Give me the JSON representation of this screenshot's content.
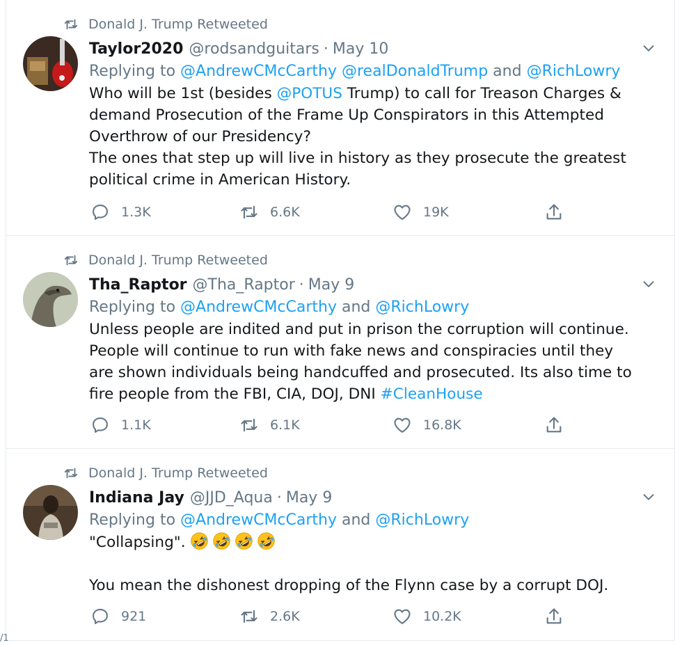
{
  "tweets": [
    {
      "retweeted_by": "Donald J. Trump Retweeted",
      "name": "Taylor2020",
      "handle": "@rodsandguitars",
      "date": "May 10",
      "reply_prefix": "Replying to ",
      "reply_parts": [
        "@AndrewCMcCarthy",
        " ",
        "@realDonaldTrump",
        " and ",
        "@RichLowry"
      ],
      "text_parts": [
        "Who will be 1st (besides ",
        "@POTUS",
        " Trump) to call for Treason Charges & demand Prosecution of the Frame Up Conspirators in this Attempted Overthrow of our Presidency?\nThe ones that step up will live in history as they prosecute the greatest political crime in American History."
      ],
      "stats": {
        "replies": "1.3K",
        "retweets": "6.6K",
        "likes": "19K"
      }
    },
    {
      "retweeted_by": "Donald J. Trump Retweeted",
      "name": "Tha_Raptor",
      "handle": "@Tha_Raptor",
      "date": "May 9",
      "reply_prefix": "Replying to ",
      "reply_parts": [
        "@AndrewCMcCarthy",
        " and ",
        "@RichLowry"
      ],
      "text_parts": [
        "Unless people are indited and put in prison the corruption will continue. People will continue to run with fake news and conspiracies until they are shown individuals being handcuffed and prosecuted. Its also time to fire people from the FBI, CIA, DOJ, DNI ",
        "#CleanHouse"
      ],
      "stats": {
        "replies": "1.1K",
        "retweets": "6.1K",
        "likes": "16.8K"
      }
    },
    {
      "retweeted_by": "Donald J. Trump Retweeted",
      "name": "Indiana Jay",
      "handle": "@JJD_Aqua",
      "date": "May 9",
      "reply_prefix": "Replying to ",
      "reply_parts": [
        "@AndrewCMcCarthy",
        " and ",
        "@RichLowry"
      ],
      "text_line1": "\"Collapsing\". ",
      "emoji": "rolling-on-floor-laughing",
      "emoji_count": 4,
      "text_line2": "You mean the dishonest dropping of the Flynn case by a corrupt DOJ.",
      "stats": {
        "replies": "921",
        "retweets": "2.6K",
        "likes": "10.2K"
      }
    }
  ],
  "corner_text": "/1",
  "colors": {
    "link": "#1da1f2",
    "muted": "#657786",
    "text": "#14171a",
    "border": "#e6ecf0"
  }
}
